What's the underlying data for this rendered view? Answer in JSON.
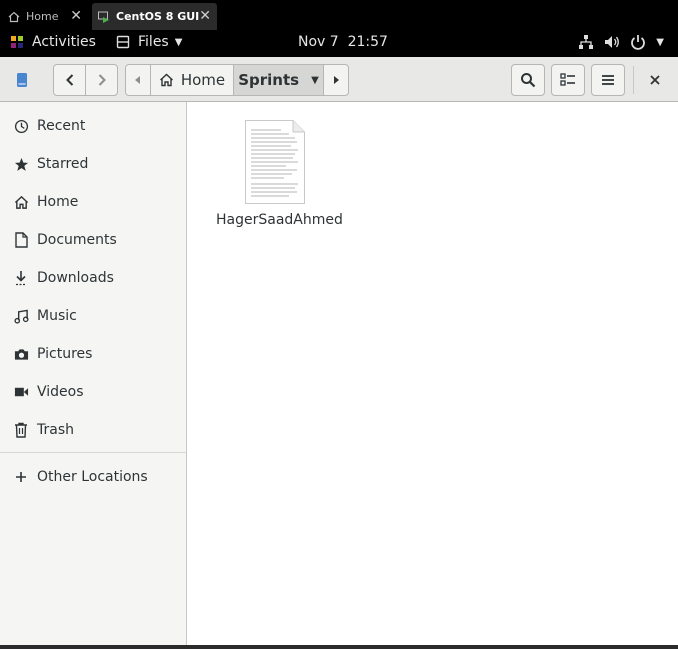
{
  "browser_tabs": [
    {
      "label": "Home",
      "icon": "home-icon",
      "active": false
    },
    {
      "label": "CentOS 8 GUI",
      "icon": "vm-icon",
      "active": true
    }
  ],
  "topbar": {
    "activities": "Activities",
    "app_menu": "Files",
    "clock": "Nov 7  21:57"
  },
  "headerbar": {
    "path": [
      "Home",
      "Sprints"
    ]
  },
  "sidebar": {
    "items": [
      {
        "label": "Recent",
        "icon": "clock-icon"
      },
      {
        "label": "Starred",
        "icon": "star-icon"
      },
      {
        "label": "Home",
        "icon": "home-icon"
      },
      {
        "label": "Documents",
        "icon": "document-icon"
      },
      {
        "label": "Downloads",
        "icon": "download-icon"
      },
      {
        "label": "Music",
        "icon": "music-icon"
      },
      {
        "label": "Pictures",
        "icon": "camera-icon"
      },
      {
        "label": "Videos",
        "icon": "video-icon"
      },
      {
        "label": "Trash",
        "icon": "trash-icon"
      }
    ],
    "other": {
      "label": "Other Locations",
      "icon": "plus-icon"
    }
  },
  "files": [
    {
      "name": "HagerSaadAhmed",
      "icon": "text-document-icon"
    }
  ],
  "colors": {
    "accent": "#2e3436",
    "headerbar": "#e8e8e7",
    "sidebar": "#f5f5f4"
  }
}
